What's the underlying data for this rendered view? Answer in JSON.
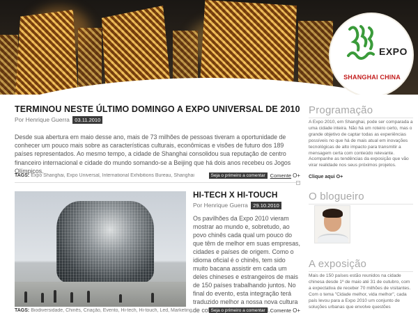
{
  "banner": {
    "logo": {
      "expo": "EXPO",
      "city": "SHANGHAI CHINA",
      "mark_text": "2010"
    }
  },
  "posts": [
    {
      "title": "TERMINOU NESTE ÚLTIMO DOMINGO A EXPO UNIVERSAL DE 2010",
      "author": "Por Henrique Guerra",
      "date": "03.11.2010",
      "excerpt": "Desde sua abertura em maio desse ano, mais de 73 milhões de pessoas tiveram a oportunidade de conhecer um pouco mais sobre as características culturais, econômicas e visões de futuro dos 189 países representados. Ao mesmo tempo, a cidade de Shanghai consolidou sua reputação de centro financeiro internacional e cidade do mundo somando-se a Beijing que há dois anos recebeu os Jogos Olímpicos.",
      "tags_label": "TAGS:",
      "tags": "Expo Shanghai, Expo Universal, International Exhibitions Bureau, Shanghai",
      "first_comment_label": "Seja o primeiro a comentar",
      "comment_label": "Comente",
      "comment_plus": "O+"
    },
    {
      "title": "HI-TECH X HI-TOUCH",
      "author": "Por Henrique Guerra",
      "date": "29.10.2010",
      "excerpt": "Os pavilhões da Expo 2010 vieram mostrar ao mundo e, sobretudo, ao povo chinês cada qual um pouco do que têm de melhor em suas empresas, cidades e países de origem. Como o idioma oficial é o chinês, tem sido muito bacana assistir em cada um deles chineses e estrangeiros de mais de 150 países trabalhando juntos. No final do evento, esta integração terá traduzido melhor a nossa nova cultura de colaboração sustentável.",
      "tags_label": "TAGS:",
      "tags": "Biodiversidade, Chinês, Criação, Evento, Hi-tech, Hi-touch, Led, Marketing,",
      "first_comment_label": "Seja o primeiro a comentar",
      "comment_label": "Comente",
      "comment_plus": "O+"
    }
  ],
  "sidebar": {
    "programacao": {
      "heading": "Programação",
      "text": "A Expo 2010, em Shanghai, pode ser comparada a uma cidade inteira. Não há um roteiro certo, mas o grande objetivo de captar todas as experiências possíveis no que há de mais atual em inovações tecnológicas de alto impacto para transmitir a mensagem certa com conteúdo relevante. Acompanhe as tendências da exposição que vão virar realidade nos seus próximos projetos.",
      "link": "Clique aqui O+"
    },
    "blogueiro": {
      "heading": "O blogueiro"
    },
    "exposicao": {
      "heading": "A exposição",
      "text": "Mais de 150 países estão reunidos na cidade chinesa desde 1º de maio até 31 de outubro, com a expectativa de receber 70 milhões de visitantes. Com o tema \"Cidade melhor, vida melhor\", cada país levou para a Expo 2010 um conjunto de soluções urbanas que envolve questões"
    }
  }
}
